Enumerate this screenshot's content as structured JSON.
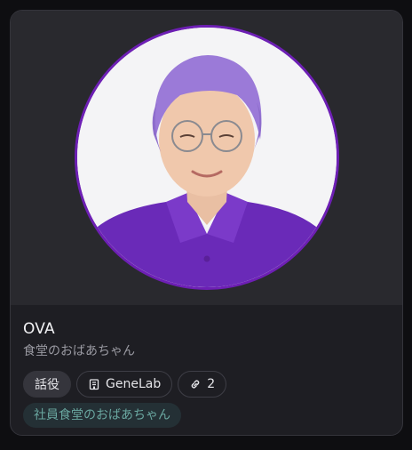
{
  "character": {
    "name": "OVA",
    "subtitle": "食堂のおばあちゃん"
  },
  "chips": {
    "role": "話役",
    "studio": "GeneLab",
    "links": "2"
  },
  "tag": "社員食堂のおばあちゃん",
  "icons": {
    "studio": "building-icon",
    "links": "link-icon"
  },
  "colors": {
    "avatar_ring": "#6d1fb4",
    "tag_text": "#6aa7a0",
    "tag_bg": "#243035"
  }
}
